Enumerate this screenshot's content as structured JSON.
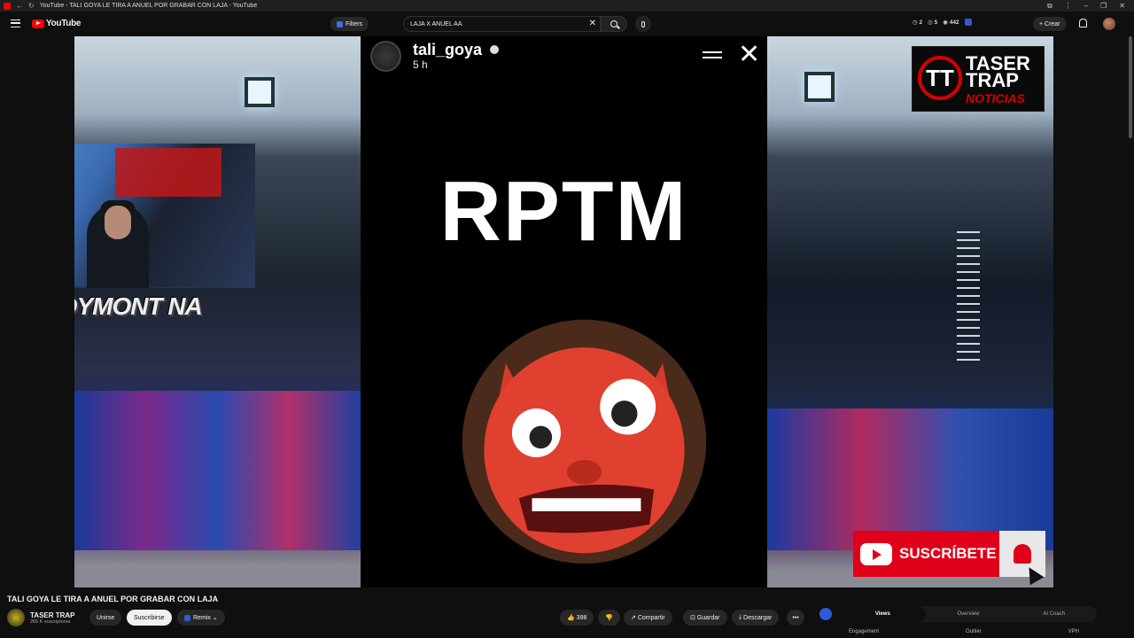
{
  "browser": {
    "tab_title": "YouTube - TALI GOYA LE TIRA A ANUEL POR GRABAR CON LAJA - YouTube"
  },
  "header": {
    "logo_text": "YouTube",
    "filters_label": "Filters",
    "search_value": "LAJA X ANUEL AA",
    "stats": [
      "2",
      "5",
      "442"
    ],
    "create_label": "+ Crear"
  },
  "video": {
    "story_user": "tali_goya",
    "story_time": "5 h",
    "story_text": "RPTM",
    "overlay_tag": "SOYMONT NA",
    "brand": {
      "line1": "TASER",
      "line2": "TRAP",
      "line3": "NOTICIAS",
      "mark": "TT"
    },
    "subscribe_overlay": "SUSCRÍBETE"
  },
  "info": {
    "title": "TALI GOYA LE TIRA A ANUEL POR GRABAR CON LAJA",
    "channel_name": "TASER TRAP",
    "channel_subs": "266 K suscriptores",
    "join_label": "Unirse",
    "subscribe_label": "Suscribirse",
    "remix_label": "Remix",
    "likes": "398",
    "share_label": "Compartir",
    "save_label": "Guardar",
    "download_label": "Descargar",
    "more_label": "•••"
  },
  "panel": {
    "tabs": [
      "Views",
      "Overview",
      "AI Coach"
    ],
    "columns": [
      "Engagement",
      "Outlier",
      "VPH"
    ]
  }
}
